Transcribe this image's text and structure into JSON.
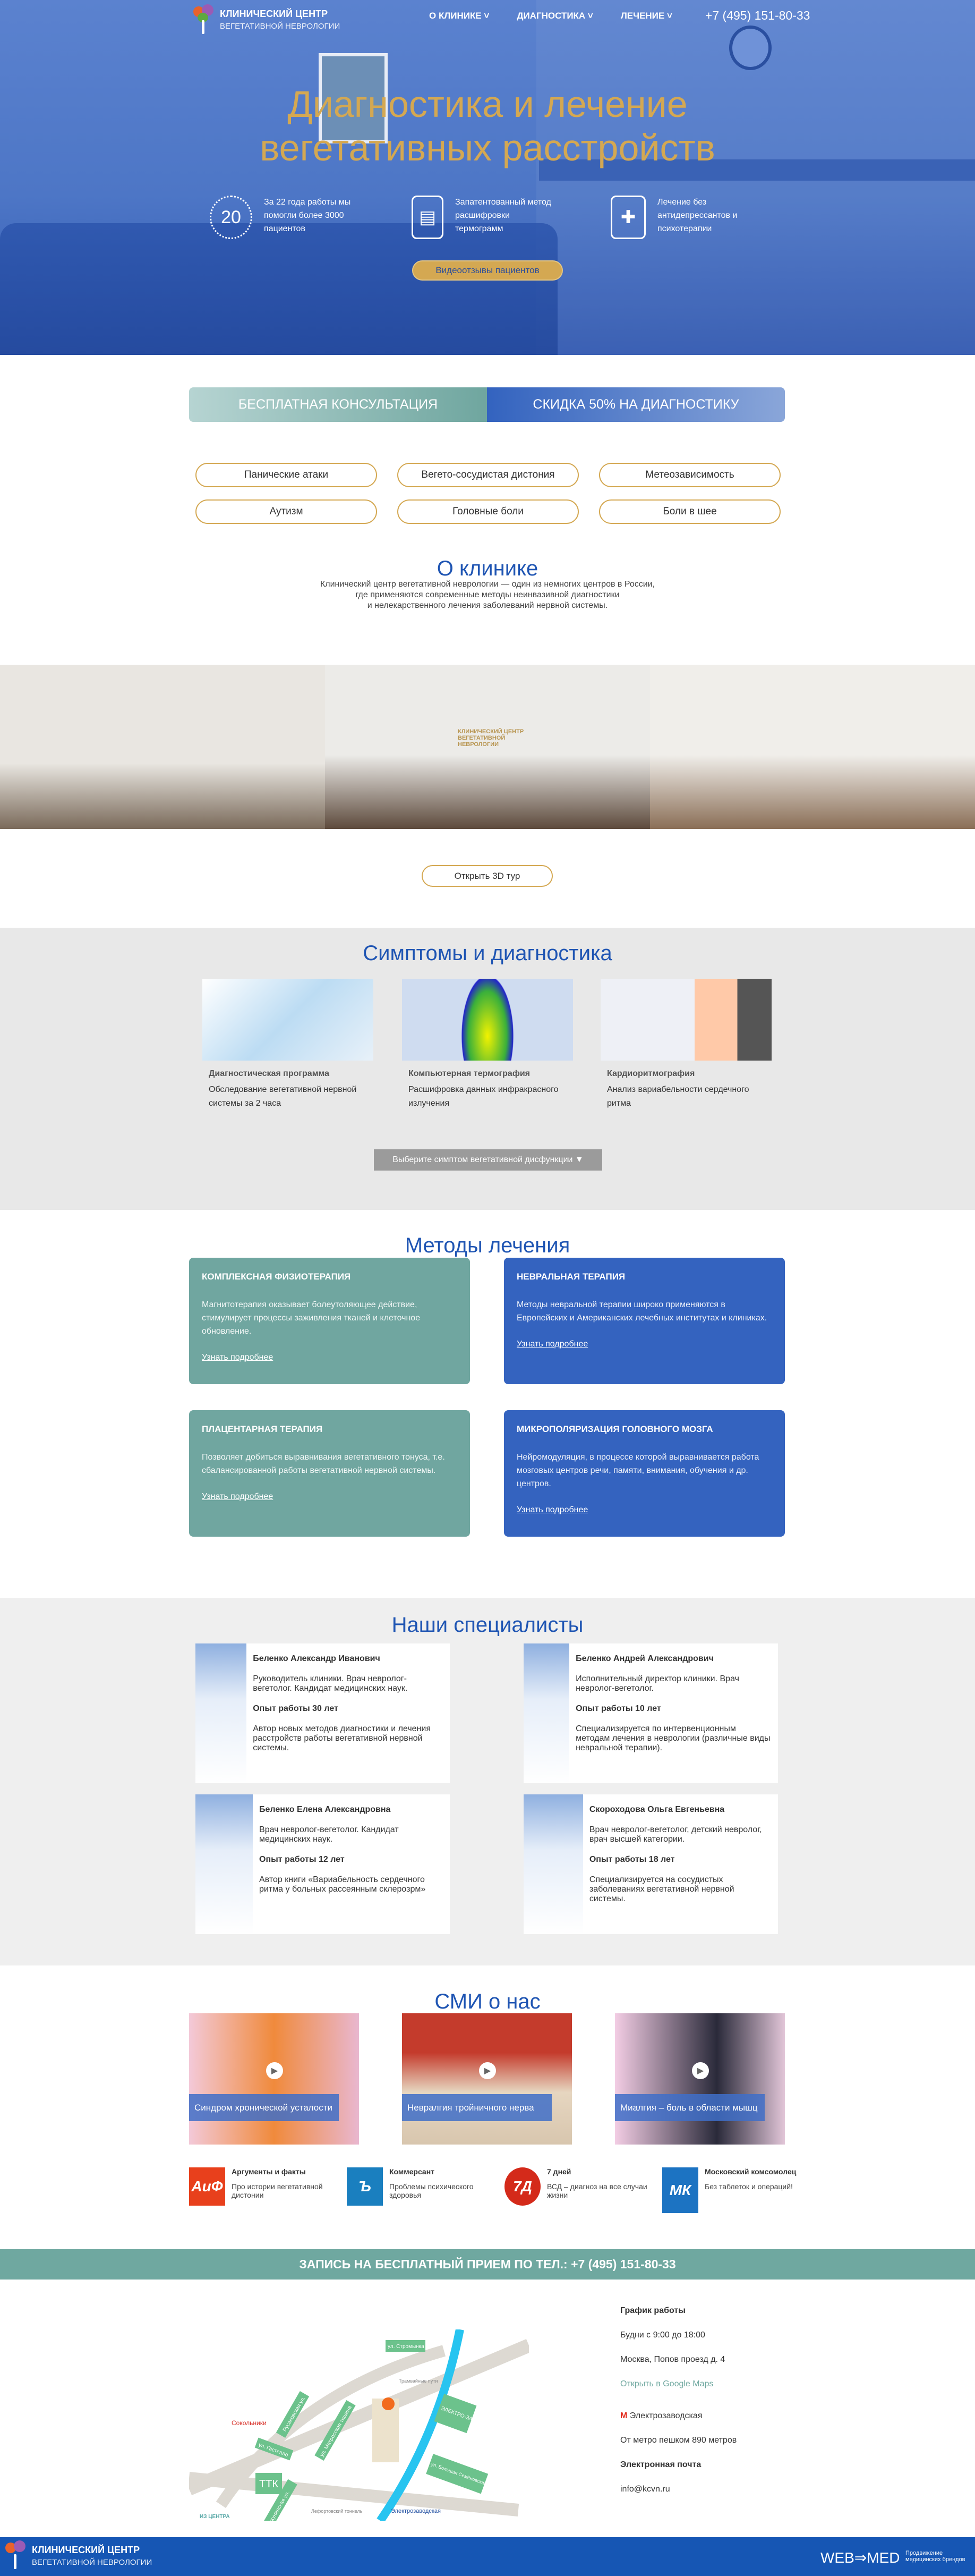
{
  "header": {
    "logo_line1": "КЛИНИЧЕСКИЙ ЦЕНТР",
    "logo_line2": "ВЕГЕТАТИВНОЙ НЕВРОЛОГИИ",
    "nav": [
      "О КЛИНИКЕ",
      "ДИАГНОСТИКА",
      "ЛЕЧЕНИЕ"
    ],
    "phone": "+7 (495) 151-80-33"
  },
  "hero": {
    "title_line1": "Диагностика и лечение",
    "title_line2": "вегетативных расстройств",
    "features": [
      {
        "icon": "laurel-20-icon",
        "badge": "20",
        "text": "За 22 года работы мы помогли более 3000 пациентов"
      },
      {
        "icon": "certificate-icon",
        "text": "Запатентованный метод расшифровки термограмм"
      },
      {
        "icon": "pill-bottle-icon",
        "text": "Лечение без антидепрессантов и психотерапии"
      }
    ],
    "button": "Видеоотзывы пациентов"
  },
  "promo": {
    "left": "БЕСПЛАТНАЯ КОНСУЛЬТАЦИЯ",
    "right": "СКИДКА 50% НА ДИАГНОСТИКУ"
  },
  "symptoms": [
    "Панические атаки",
    "Вегето-сосудистая дистония",
    "Метеозависимость",
    "Аутизм",
    "Головные боли",
    "Боли в шее"
  ],
  "about": {
    "title": "О клинике",
    "text1": "Клинический центр вегетативной неврологии — один из немногих центров в России,",
    "text2": "где применяются современные методы неинвазивной диагностики",
    "text3": "и нелекарственного лечения заболеваний нервной системы.",
    "tour_button": "Открыть 3D тур",
    "room_sign": "КЛИНИЧЕСКИЙ ЦЕНТР ВЕГЕТАТИВНОЙ НЕВРОЛОГИИ"
  },
  "diagnostics": {
    "title": "Симптомы и диагностика",
    "items": [
      {
        "title": "Диагностическая программа",
        "text": "Обследование вегетативной нервной системы за 2 часа"
      },
      {
        "title": "Компьютерная термография",
        "text": "Расшифровка данных инфракрасного излучения"
      },
      {
        "title": "Кардиоритмография",
        "text": "Анализ вариабельности сердечного ритма"
      }
    ],
    "dropdown": "Выберите симптом вегетативной дисфункции ▼"
  },
  "methods": {
    "title": "Методы лечения",
    "more": "Узнать подробнее",
    "items": [
      {
        "title": "КОМПЛЕКСНАЯ ФИЗИОТЕРАПИЯ",
        "text": "Магнитотерапия оказывает болеутоляющее действие, стимулирует процессы заживления тканей и клеточное обновление."
      },
      {
        "title": "НЕВРАЛЬНАЯ ТЕРАПИЯ",
        "text": "Методы невральной терапии широко применяются в Европейских и Американских лечебных институтах и клиниках."
      },
      {
        "title": "ПЛАЦЕНТАРНАЯ ТЕРАПИЯ",
        "text": "Позволяет добиться выравнивания вегетативного тонуса, т.е. сбалансированной работы вегетативной нервной системы."
      },
      {
        "title": "МИКРОПОЛЯРИЗАЦИЯ ГОЛОВНОГО МОЗГА",
        "text": "Нейромодуляция, в процессе которой выравнивается работа мозговых центров речи, памяти, внимания, обучения и др. центров."
      }
    ]
  },
  "specialists": {
    "title": "Наши специалисты",
    "items": [
      {
        "name": "Беленко Александр Иванович",
        "role": "Руководитель клиники. Врач невролог-вегетолог. Кандидат медицинских наук.",
        "exp": "Опыт работы 30 лет",
        "about": "Автор новых методов диагностики и лечения расстройств работы вегетативной нервной системы."
      },
      {
        "name": "Беленко Андрей Александрович",
        "role": "Исполнительный директор клиники. Врач невролог-вегетолог.",
        "exp": "Опыт работы 10 лет",
        "about": "Специализируется по интервенционным методам лечения в неврологии (различные виды невральной терапии)."
      },
      {
        "name": "Беленко Елена Александровна",
        "role": "Врач невролог-вегетолог. Кандидат медицинских наук.",
        "exp": "Опыт работы 12 лет",
        "about": "Автор книги «Вариабельность сердечного ритма у больных рассеянным склерозрм»"
      },
      {
        "name": "Скороходова Ольга Евгеньевна",
        "role": "Врач невролог-вегетолог, детский невролог, врач высшей категории.",
        "exp": "Опыт работы 18 лет",
        "about": "Специализируется на сосудистых заболеваниях вегетативной нервной системы."
      }
    ]
  },
  "media": {
    "title": "СМИ о нас",
    "videos": [
      "Синдром хронической усталости",
      "Невралгия тройничного нерва",
      "Миалгия – боль в области мышц"
    ],
    "press": [
      {
        "logo": "АиФ",
        "name": "Аргументы и факты",
        "text": "Про истории вегетативной дистонии",
        "color": "#e8401c"
      },
      {
        "logo": "Ъ",
        "name": "Коммерсант",
        "text": "Проблемы психического здоровья",
        "color": "#1a7fbf"
      },
      {
        "logo": "7Д",
        "name": "7 дней",
        "text": "ВСД – диагноз на все случаи жизни",
        "color": "#d42a1a"
      },
      {
        "logo": "МК",
        "name": "Московский комсомолец",
        "text": "Без таблеток и операций!",
        "color": "#1c73c2"
      }
    ]
  },
  "cta": "ЗАПИСЬ НА БЕСПЛАТНЫЙ ПРИЕМ ПО ТЕЛ.: +7 (495) 151-80-33",
  "map": {
    "labels": [
      "ул. Стромынка",
      "Русаковская ул.",
      "ул. Матросская тишина",
      "Сокольники",
      "ул. Гастелло",
      "ТТК",
      "Бакунинская ул.",
      "Лефортовский тоннель",
      "ИЗ ЦЕНТРА",
      "Электрозаводская",
      "р. Яуза",
      "ЭЛЕКТРО-ЗАВОД",
      "ул. Большая Семёновская",
      "Трамвайные пути"
    ]
  },
  "contacts": {
    "hours_title": "График работы",
    "hours": "Будни с 9:00 до 18:00",
    "address": "Москва, Попов проезд д. 4",
    "maps_link": "Открыть в Google Maps",
    "metro": "Электрозаводская",
    "walk": "От метро пешком 890 метров",
    "email_title": "Электронная почта",
    "email": "info@kcvn.ru",
    "accent": "#6fa8a0"
  },
  "footer": {
    "logo_line1": "КЛИНИЧЕСКИЙ ЦЕНТР",
    "logo_line2": "ВЕГЕТАТИВНОЙ НЕВРОЛОГИИ",
    "webmed": "WEB⇒MED",
    "webmed_sub": "Продвижение медицинских брендов"
  }
}
